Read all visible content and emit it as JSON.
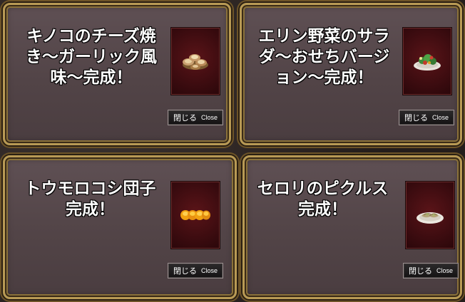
{
  "dialogs": [
    {
      "title": "キノコのチーズ焼\nき〜ガーリック風\n味〜完成！",
      "item_icon": "grilled-mushroom-icon",
      "close_jp": "閉じる",
      "close_en": "Close"
    },
    {
      "title": "エリン野菜のサラ\nダ〜おせちバージ\nョン〜完成！",
      "item_icon": "salad-plate-icon",
      "close_jp": "閉じる",
      "close_en": "Close"
    },
    {
      "title": "トウモロコシ団子\n完成！",
      "item_icon": "corn-dumpling-icon",
      "close_jp": "閉じる",
      "close_en": "Close"
    },
    {
      "title": "セロリのピクルス\n完成！",
      "item_icon": "pickles-plate-icon",
      "close_jp": "閉じる",
      "close_en": "Close"
    }
  ],
  "colors": {
    "panel": "#564749",
    "frame_gold": "#b89a55",
    "item_bg": "#4a1014",
    "title_text": "#ffffff"
  }
}
